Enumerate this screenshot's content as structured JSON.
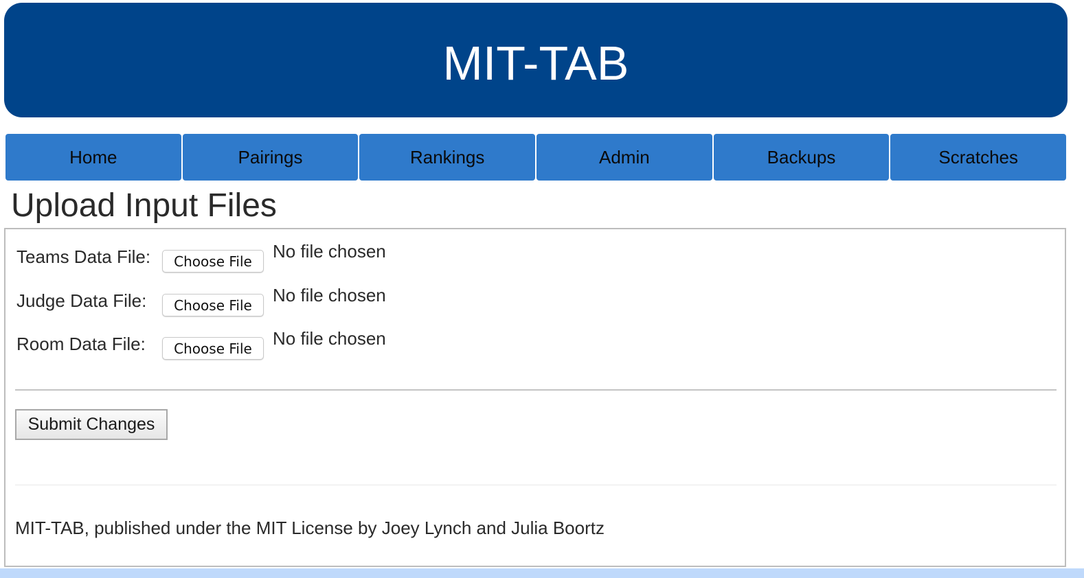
{
  "header": {
    "title": "MIT-TAB"
  },
  "nav": {
    "items": [
      {
        "label": "Home"
      },
      {
        "label": "Pairings"
      },
      {
        "label": "Rankings"
      },
      {
        "label": "Admin"
      },
      {
        "label": "Backups"
      },
      {
        "label": "Scratches"
      }
    ]
  },
  "page": {
    "title": "Upload Input Files"
  },
  "form": {
    "fields": [
      {
        "label": "Teams Data File:",
        "button_label": "Choose File",
        "status": "No file chosen"
      },
      {
        "label": "Judge Data File:",
        "button_label": "Choose File",
        "status": "No file chosen"
      },
      {
        "label": "Room Data File:",
        "button_label": "Choose File",
        "status": "No file chosen"
      }
    ],
    "submit_label": "Submit Changes"
  },
  "footer": {
    "text": "MIT-TAB, published under the MIT License by Joey Lynch and Julia Boortz"
  },
  "colors": {
    "header_bg": "#00448a",
    "nav_bg": "#2f7acb",
    "bottom_band": "#bfd9fb"
  }
}
